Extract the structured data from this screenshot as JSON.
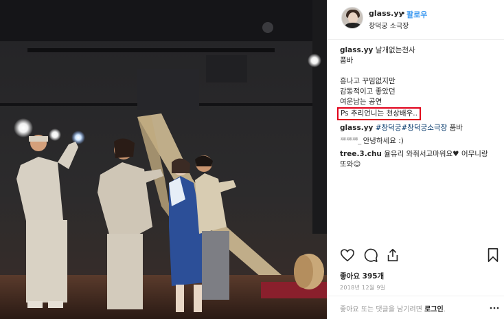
{
  "post": {
    "username": "glass.yy",
    "dot": "•",
    "follow_label": "팔로우",
    "location": "창덕궁 소극장"
  },
  "caption": {
    "username": "glass.yy",
    "line1": "날개없는천사",
    "line2": "품바",
    "line3": "흥나고 꾸밈없지만",
    "line4": "감동적이고 좋았던",
    "line5": "여운남는 공연",
    "highlight": "Ps 추리언니는 천상배우.."
  },
  "comments": [
    {
      "username": "glass.yy",
      "tags": "#창덕궁#창덕궁소극장",
      "text": "품바"
    },
    {
      "username": "ꥸꥸꥸ_",
      "text": "안녕하세요 :)"
    },
    {
      "username": "tree.3.chu",
      "text": "율유리 와줘서고마워요♥ 어무니랑",
      "text2": "또와☺"
    }
  ],
  "actions": {
    "like_icon": "heart-icon",
    "comment_icon": "comment-icon",
    "share_icon": "share-icon",
    "save_icon": "bookmark-icon"
  },
  "likes": "좋아요 395개",
  "date": "2018년 12월 9일",
  "footer": {
    "text": "좋아요 또는 댓글을 남기려면 ",
    "login_label": "로그인",
    "suffix": "."
  },
  "colors": {
    "accent": "#3897f0",
    "highlight_border": "#e0001a",
    "muted": "#999999"
  }
}
